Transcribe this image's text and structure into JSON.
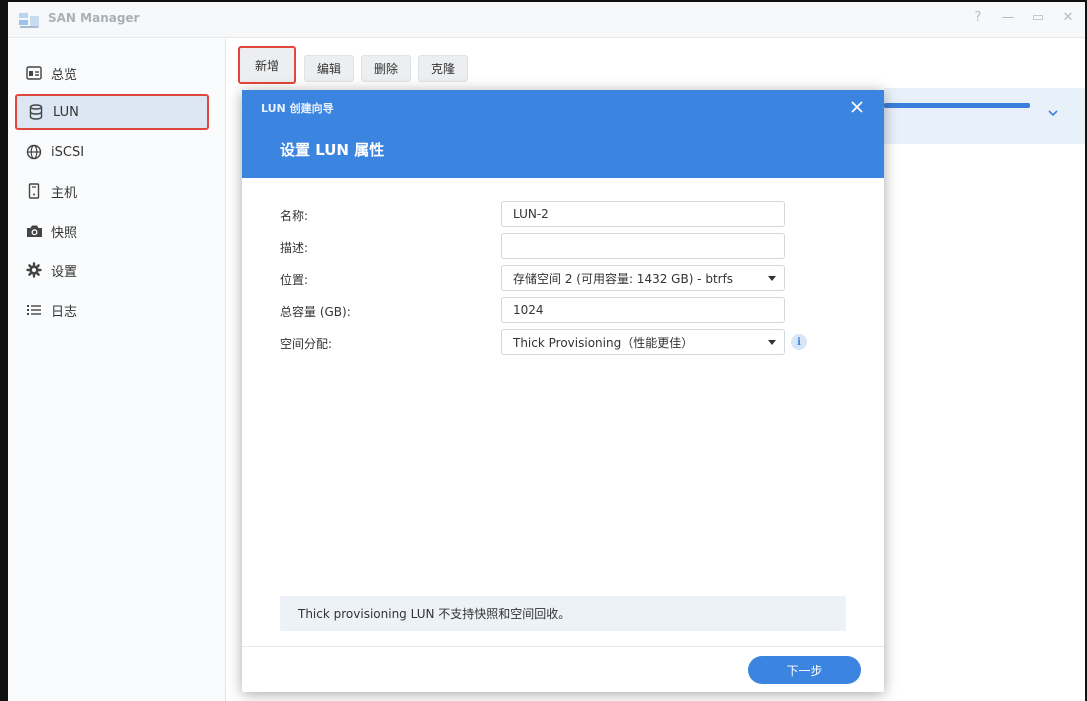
{
  "app": {
    "title": "SAN Manager"
  },
  "window_controls": {
    "help": "?",
    "minimize": "—",
    "maximize": "▭",
    "close": "✕"
  },
  "sidebar": {
    "items": [
      {
        "label": "总览",
        "icon": "overview-icon"
      },
      {
        "label": "LUN",
        "icon": "database-icon",
        "active": true
      },
      {
        "label": "iSCSI",
        "icon": "globe-icon"
      },
      {
        "label": "主机",
        "icon": "host-icon"
      },
      {
        "label": "快照",
        "icon": "camera-icon"
      },
      {
        "label": "设置",
        "icon": "gear-icon"
      },
      {
        "label": "日志",
        "icon": "list-icon"
      }
    ]
  },
  "toolbar": {
    "create_label": "新增",
    "edit_label": "编辑",
    "delete_label": "删除",
    "clone_label": "克隆"
  },
  "dialog": {
    "caption": "LUN 创建向导",
    "heading": "设置 LUN 属性",
    "fields": {
      "name": {
        "label": "名称:",
        "value": "LUN-2"
      },
      "description": {
        "label": "描述:",
        "value": ""
      },
      "location": {
        "label": "位置:",
        "value": "存储空间 2 (可用容量: 1432 GB) - btrfs"
      },
      "capacity": {
        "label": "总容量 (GB):",
        "value": "1024"
      },
      "allocation": {
        "label": "空间分配:",
        "value": "Thick Provisioning（性能更佳）"
      }
    },
    "notice": "Thick provisioning LUN 不支持快照和空间回收。",
    "next_label": "下一步"
  },
  "colors": {
    "accent": "#3b84e0",
    "highlight_border": "#e0473c",
    "active_nav_bg": "#dde7f4"
  }
}
